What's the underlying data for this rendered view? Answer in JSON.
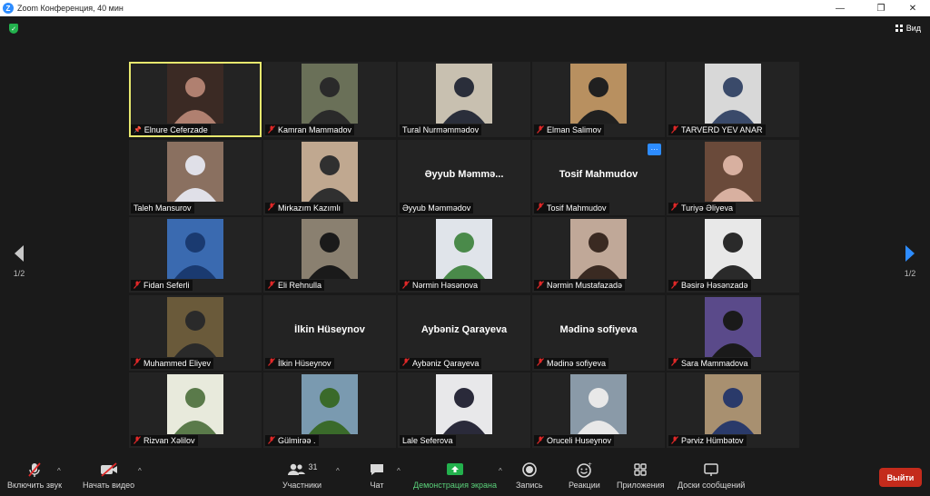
{
  "window": {
    "title": "Zoom Конференция, 40 мин",
    "logo_letter": "Z",
    "minimize": "—",
    "restore": "❐",
    "close": "✕"
  },
  "topbar": {
    "view_label": "Вид"
  },
  "colors": {
    "accent": "#2d8cff",
    "active_speaker": "#e7e86e",
    "muted": "#e02828",
    "leave": "#c42b1c",
    "share": "#23b14d"
  },
  "participants": [
    {
      "name": "Elnure Ceferzade",
      "video": true,
      "muted": false,
      "pinned": true,
      "active": true,
      "bg": "#3b2a24",
      "fg": "#b08070"
    },
    {
      "name": "Kamran Mammadov",
      "video": true,
      "muted": true,
      "bg": "#6a7058",
      "fg": "#2a2a2a"
    },
    {
      "name": "Tural Nurməmmədov",
      "video": true,
      "muted": false,
      "bg": "#c8c0b0",
      "fg": "#2a2e3a"
    },
    {
      "name": "Elman Salimov",
      "video": true,
      "muted": true,
      "bg": "#b89060",
      "fg": "#202020"
    },
    {
      "name": "TARVERD YEV ANAR",
      "video": true,
      "muted": true,
      "bg": "#d8d8d8",
      "fg": "#3a4a6a"
    },
    {
      "name": "Taleh Mansurov",
      "video": true,
      "muted": false,
      "bg": "#8a7060",
      "fg": "#e0e0e8"
    },
    {
      "name": "Mirkazım Kazımlı",
      "video": true,
      "muted": true,
      "bg": "#c0a890",
      "fg": "#303030"
    },
    {
      "name": "Əyyub Məmmədov",
      "video": false,
      "muted": false,
      "big": "Əyyub  Məmmə..."
    },
    {
      "name": "Tosif Mahmudov",
      "video": false,
      "muted": true,
      "big": "Tosif Mahmudov",
      "more": "···"
    },
    {
      "name": "Turiyə Əliyeva",
      "video": true,
      "muted": true,
      "bg": "#6a4a3a",
      "fg": "#d8b0a0"
    },
    {
      "name": "Fidan Seferli",
      "video": true,
      "muted": true,
      "bg": "#3a6ab0",
      "fg": "#1a3a70"
    },
    {
      "name": "Eli Rehnulla",
      "video": true,
      "muted": true,
      "bg": "#8a8070",
      "fg": "#1a1a1a"
    },
    {
      "name": "Nərmin Həsənova",
      "video": true,
      "muted": true,
      "bg": "#e0e4ea",
      "fg": "#4a8a4a"
    },
    {
      "name": "Nərmin Mustafazadə",
      "video": true,
      "muted": true,
      "bg": "#c0a898",
      "fg": "#3a2a22"
    },
    {
      "name": "Bəsirə Həsənzadə",
      "video": true,
      "muted": true,
      "bg": "#e8e8e8",
      "fg": "#2a2a2a"
    },
    {
      "name": "Muhammed Eliyev",
      "video": true,
      "muted": true,
      "bg": "#6a5a3a",
      "fg": "#2a2a2a"
    },
    {
      "name": "İlkin Hüseynov",
      "video": false,
      "muted": true,
      "big": "İlkin Hüseynov"
    },
    {
      "name": "Aybəniz Qarayeva",
      "video": false,
      "muted": true,
      "big": "Aybəniz Qarayeva"
    },
    {
      "name": "Mədinə sofiyeva",
      "video": false,
      "muted": true,
      "big": "Mədinə sofiyeva"
    },
    {
      "name": "Sara Mammadova",
      "video": true,
      "muted": true,
      "bg": "#5a4a8a",
      "fg": "#1a1a1a"
    },
    {
      "name": "Rizvan Xəlilov",
      "video": true,
      "muted": true,
      "bg": "#e8eadc",
      "fg": "#5a7a4a"
    },
    {
      "name": "Gülmirəə .",
      "video": true,
      "muted": true,
      "bg": "#7a9ab0",
      "fg": "#3a6a2a"
    },
    {
      "name": "Lale Seferova",
      "video": true,
      "muted": false,
      "bg": "#e8e8ea",
      "fg": "#2a2a3a"
    },
    {
      "name": "Oruceli Huseynov",
      "video": true,
      "muted": true,
      "bg": "#8a9aa8",
      "fg": "#e8e8e8"
    },
    {
      "name": "Pərviz Hümbətov",
      "video": true,
      "muted": true,
      "bg": "#a89070",
      "fg": "#2a3a6a"
    }
  ],
  "pager": {
    "left_label": "1/2",
    "right_label": "1/2"
  },
  "toolbar": {
    "audio": "Включить звук",
    "video": "Начать видео",
    "participants": "Участники",
    "participants_count": "31",
    "chat": "Чат",
    "share": "Демонстрация экрана",
    "record": "Запись",
    "reactions": "Реакции",
    "apps": "Приложения",
    "whiteboard": "Доски сообщений",
    "leave": "Выйти",
    "caret": "^"
  }
}
